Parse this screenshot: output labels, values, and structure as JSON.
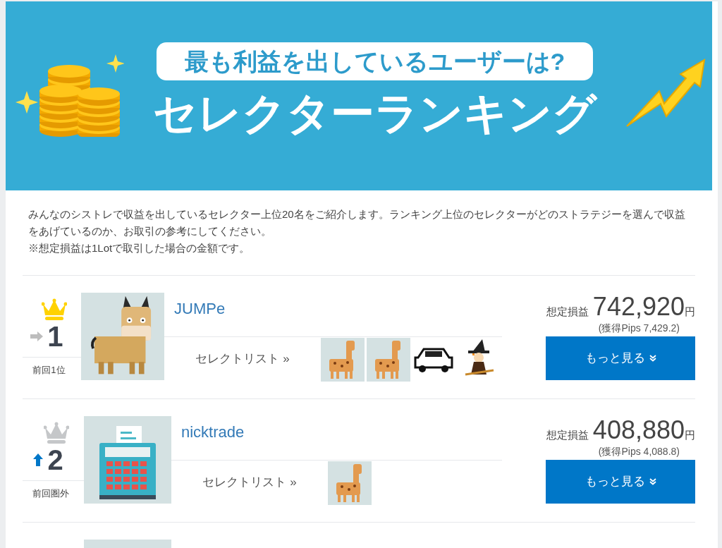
{
  "banner": {
    "subtitle": "最も利益を出しているユーザーは?",
    "title": "セレクターランキング"
  },
  "intro": [
    "みんなのシストレで収益を出しているセレクター上位20名をご紹介します。ランキング上位のセレクターがどのストラテジーを選んで収益をあげているのか、お取引の参考にしてください。",
    "※想定損益は1Lotで取引した場合の金額です。"
  ],
  "rankings": [
    {
      "rank": "1",
      "crown": {
        "color": "#ffd200"
      },
      "trend": {
        "kind": "same"
      },
      "previous": "前回1位",
      "avatar": {
        "kind": "lynx"
      },
      "name": "JUMPe",
      "profit_label": "想定損益",
      "profit": "742,920",
      "unit": "円",
      "pips": "(獲得Pips 7,429.2)",
      "list_link": "セレクトリスト »",
      "picks": [
        {
          "kind": "giraffe"
        },
        {
          "kind": "giraffe"
        },
        {
          "kind": "car"
        },
        {
          "kind": "witch"
        }
      ],
      "more": "もっと見る"
    },
    {
      "rank": "2",
      "crown": {
        "color": "#c5c7c9"
      },
      "trend": {
        "kind": "up"
      },
      "previous": "前回圏外",
      "avatar": {
        "kind": "calculator"
      },
      "name": "nicktrade",
      "profit_label": "想定損益",
      "profit": "408,880",
      "unit": "円",
      "pips": "(獲得Pips 4,088.8)",
      "list_link": "セレクトリスト »",
      "picks": [
        {
          "kind": "giraffe"
        }
      ],
      "more": "もっと見る"
    }
  ]
}
